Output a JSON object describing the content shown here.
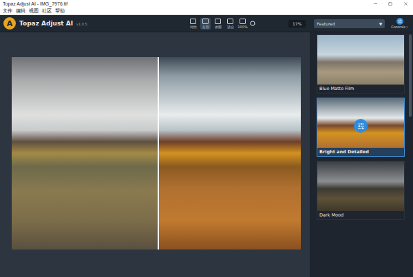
{
  "window": {
    "title": "Topaz Adjust AI - IMG_7976.tif"
  },
  "menu": [
    "文件",
    "编辑",
    "视图",
    "社区",
    "帮助"
  ],
  "app": {
    "logo": "A",
    "name": "Topaz Adjust AI",
    "version": "v1.0.5"
  },
  "view_modes": [
    {
      "label": "对比",
      "selected": false
    },
    {
      "label": "分割",
      "selected": true
    },
    {
      "label": "原图",
      "selected": false
    },
    {
      "label": "适合",
      "selected": false
    },
    {
      "label": "100%",
      "selected": false
    }
  ],
  "zoom": "17%",
  "preset_category": {
    "value": "Featured",
    "arrow": "▼"
  },
  "controls_button": "Controls",
  "presets": [
    {
      "label": "Blue Matte Film",
      "selected": false
    },
    {
      "label": "Bright and Detailed",
      "selected": true
    },
    {
      "label": "Dark Mood",
      "selected": false
    }
  ],
  "comparison": {
    "split": 0.505
  }
}
